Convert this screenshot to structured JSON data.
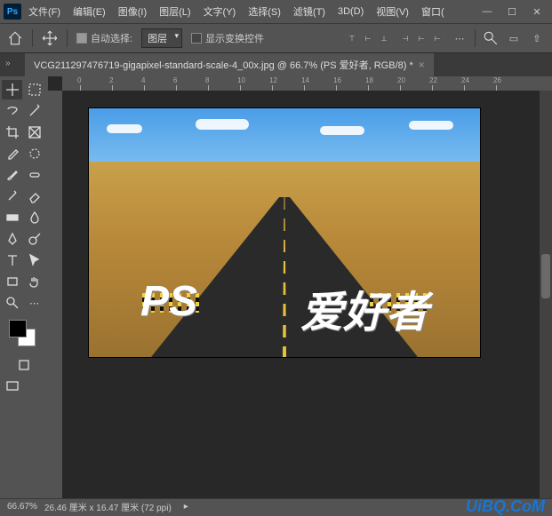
{
  "menubar": {
    "items": [
      "文件(F)",
      "编辑(E)",
      "图像(I)",
      "图层(L)",
      "文字(Y)",
      "选择(S)",
      "滤镜(T)",
      "3D(D)",
      "视图(V)",
      "窗口("
    ]
  },
  "optionsbar": {
    "auto_select_label": "自动选择:",
    "auto_select_target": "图层",
    "show_transform_label": "显示变换控件"
  },
  "tab": {
    "title": "VCG211297476719-gigapixel-standard-scale-4_00x.jpg @ 66.7% (PS    爱好者, RGB/8) *"
  },
  "ruler": {
    "ticks": [
      "0",
      "2",
      "4",
      "6",
      "8",
      "10",
      "12",
      "14",
      "16",
      "18",
      "20",
      "22",
      "24",
      "26"
    ]
  },
  "canvas": {
    "text_left": "PS",
    "text_right": "爱好者"
  },
  "status": {
    "zoom": "66.67%",
    "docsize": "26.46 厘米 x 16.47 厘米 (72 ppi)"
  },
  "watermark": "UiBQ.CoM"
}
